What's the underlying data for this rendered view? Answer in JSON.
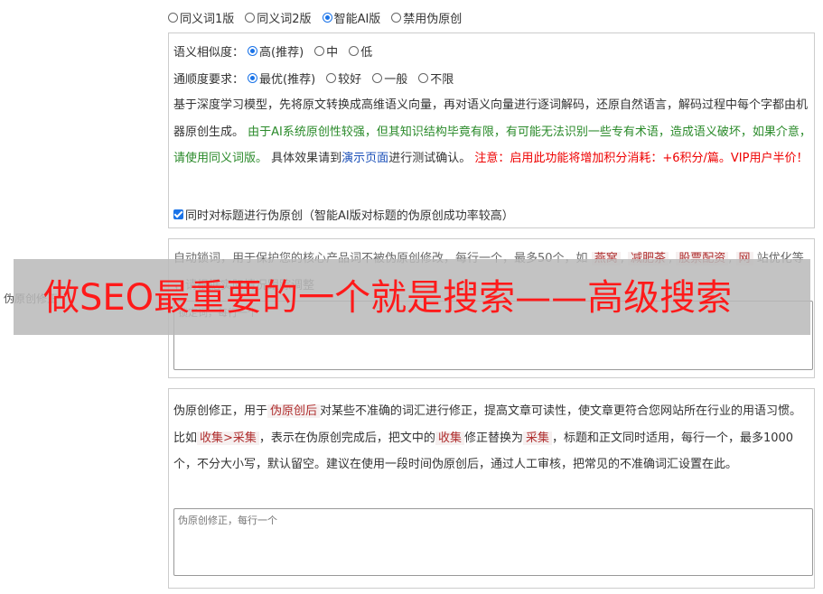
{
  "version_options": [
    {
      "label": "同义词1版",
      "selected": false
    },
    {
      "label": "同义词2版",
      "selected": false
    },
    {
      "label": "智能AI版",
      "selected": true
    },
    {
      "label": "禁用伪原创",
      "selected": false
    }
  ],
  "similarity": {
    "label": "语义相似度：",
    "options": [
      {
        "label": "高(推荐)",
        "selected": true
      },
      {
        "label": "中",
        "selected": false
      },
      {
        "label": "低",
        "selected": false
      }
    ]
  },
  "fluency": {
    "label": "通顺度要求：",
    "options": [
      {
        "label": "最优(推荐)",
        "selected": true
      },
      {
        "label": "较好",
        "selected": false
      },
      {
        "label": "一般",
        "selected": false
      },
      {
        "label": "不限",
        "selected": false
      }
    ]
  },
  "description": {
    "p1": "基于深度学习模型，先将原文转换成高维语义向量，再对语义向量进行逐词解码，还原自然语言，解码过程中每个字都由机器原创生成。",
    "green": "由于AI系统原创性较强，但其知识结构毕竟有限，有可能无法识别一些专有术语，造成语义破坏，如果介意，请使用同义词版。",
    "p2": "具体效果请到",
    "link": "演示页面",
    "p3": "进行测试确认。",
    "red": "注意：启用此功能将增加积分消耗：+6积分/篇。VIP用户半价！"
  },
  "title_checkbox": {
    "label": "同时对标题进行伪原创（智能AI版对标题的伪原创成功率较高）",
    "checked": true
  },
  "lock_words": {
    "text": "自动锁词，用于保护您的核心产品词不被伪原创修改，每行一个，最多50个，如",
    "examples": [
      "燕窝",
      "减肥茶",
      "股票配资",
      "网"
    ],
    "text2": "站优化等 ，请根据实际情况跟踪调整",
    "placeholder": "锁定词，每行一个"
  },
  "side_label": "伪原创修正",
  "correction": {
    "t1": "伪原创修正，用于",
    "chip1": "伪原创后",
    "t2": "对某些不准确的词汇进行修正，提高文章可读性，使文章更符合您网站所在行业的用语习惯。比如",
    "chip2": "收集>采集",
    "t3": "，表示在伪原创完成后，把文中的",
    "chip3": "收集",
    "t4": "修正替换为",
    "chip4": "采集",
    "t5": "，标题和正文同时适用，每行一个，最多1000个，不分大小写，默认留空。建议在使用一段时间伪原创后，通过人工审核，把常见的不准确词汇设置在此。",
    "placeholder": "伪原创修正，每行一个"
  },
  "banner": "做SEO最重要的一个就是搜索——高级搜索"
}
